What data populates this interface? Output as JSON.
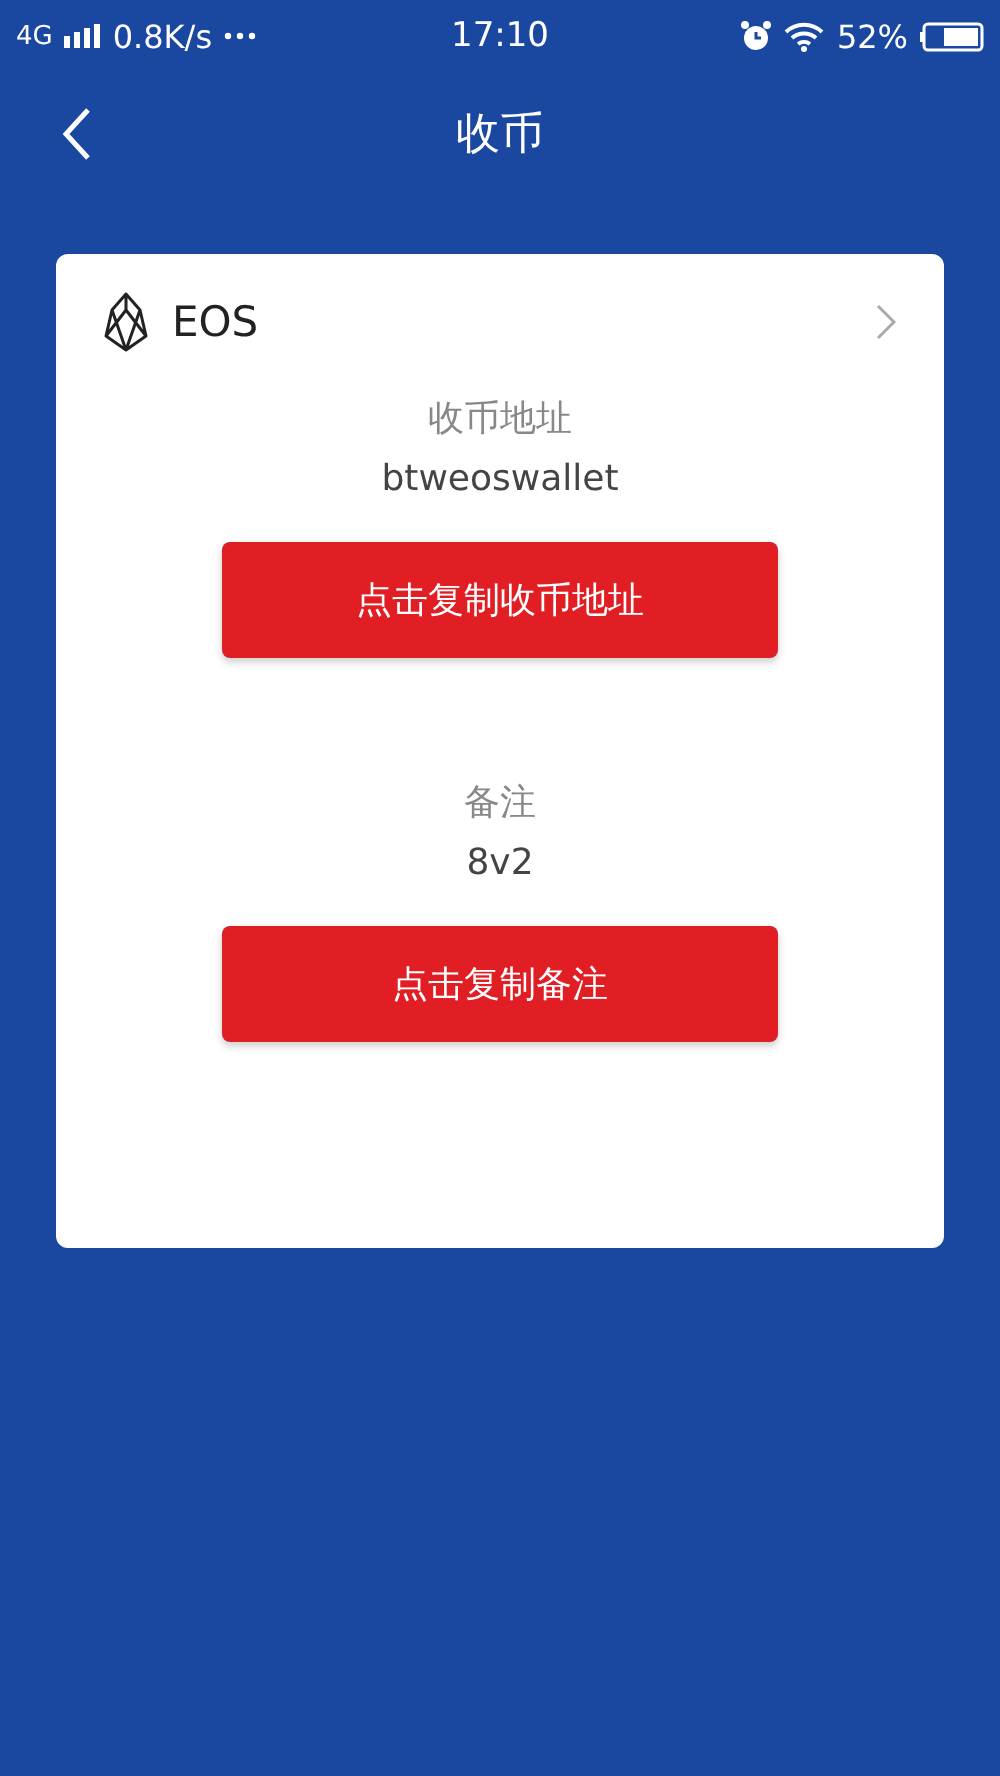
{
  "status_bar": {
    "network": "4G",
    "speed": "0.8K/s",
    "time": "17:10",
    "battery": "52%"
  },
  "header": {
    "title": "收币"
  },
  "card": {
    "coin": "EOS",
    "fields": [
      {
        "label": "收币地址",
        "value": "btweoswallet",
        "button": "点击复制收币地址"
      },
      {
        "label": "备注",
        "value": "8v2",
        "button": "点击复制备注"
      }
    ]
  }
}
